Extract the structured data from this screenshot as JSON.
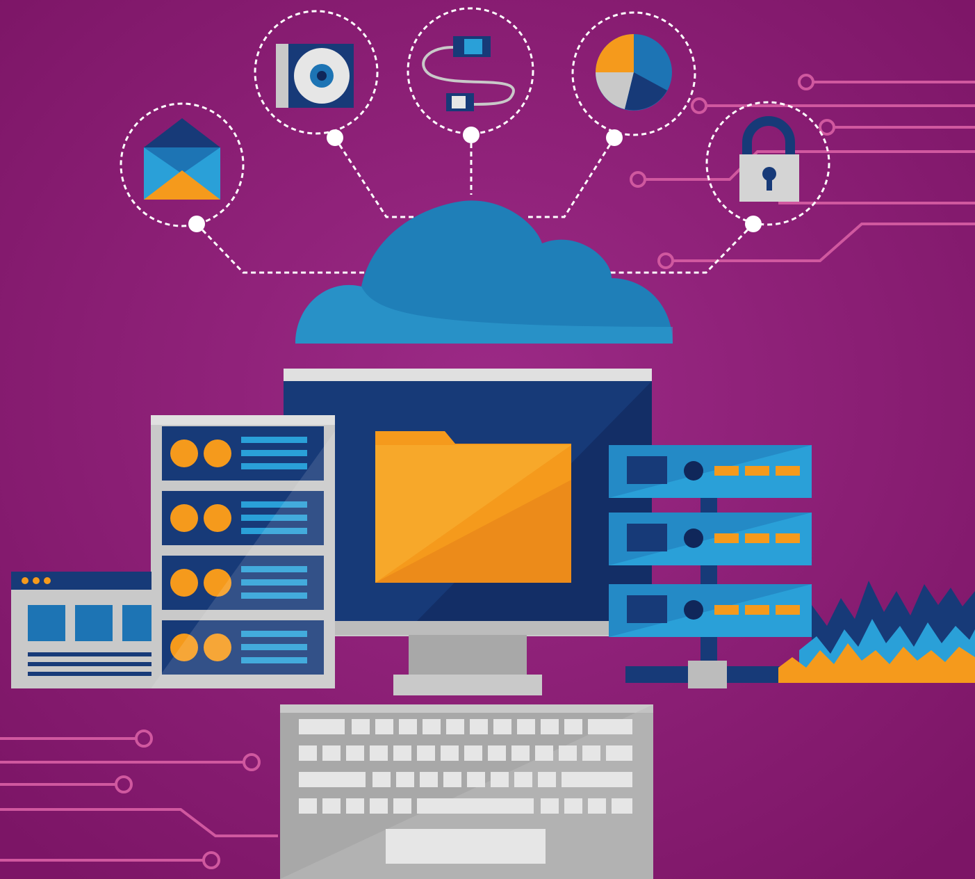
{
  "illustration": {
    "colors": {
      "background": "#88186f",
      "background_glow": "#9c2a86",
      "circuit": "#d0589f",
      "connector": "#ffffff",
      "cloud": "#1f7fb8",
      "cloud_light": "#2fa0d4",
      "navy": "#173a78",
      "navy_dark": "#10275a",
      "blue": "#1d74b4",
      "sky": "#2aa0d8",
      "orange": "#f59a1c",
      "orange_light": "#f8b233",
      "grey": "#bcbcbc",
      "grey_light": "#e6e6e6",
      "grey_dark": "#8f8f8f"
    },
    "service_icons": [
      {
        "name": "email-envelope-icon"
      },
      {
        "name": "disc-drive-icon"
      },
      {
        "name": "usb-cable-icon"
      },
      {
        "name": "pie-chart-icon"
      },
      {
        "name": "padlock-icon"
      }
    ],
    "cloud": {
      "name": "cloud-icon"
    },
    "monitor": {
      "name": "desktop-monitor",
      "screen_icon": "folder-icon"
    },
    "server_rack": {
      "name": "server-rack",
      "units": 4
    },
    "network_servers": {
      "name": "network-server-stack",
      "units": 3
    },
    "browser_window": {
      "name": "browser-window",
      "dots": 3
    },
    "keyboard": {
      "name": "keyboard",
      "rows": 4
    },
    "signal_graph": {
      "name": "waveform-graph-icon"
    }
  }
}
